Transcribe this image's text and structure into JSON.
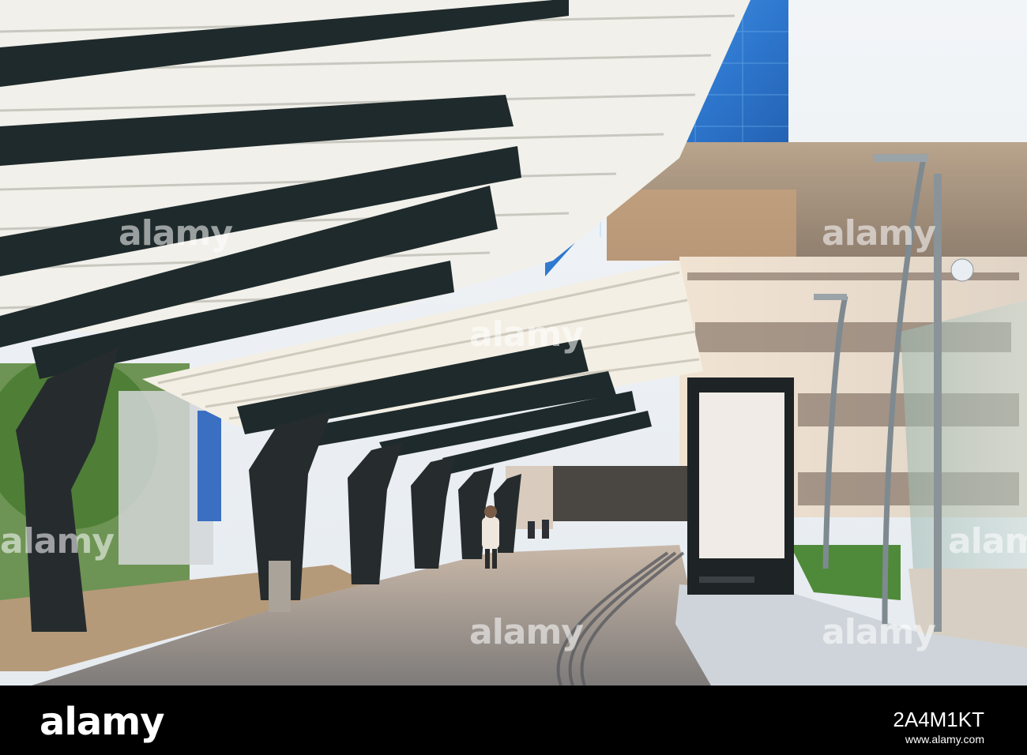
{
  "watermark": {
    "text": "alamy"
  },
  "footer": {
    "logo": "alamy",
    "image_id": "2A4M1KT",
    "url": "www.alamy.com"
  },
  "colors": {
    "sky": "#eef2f6",
    "glass_tower": "#2f7fd6",
    "beam": "#1f2a2c",
    "louver": "#f1f0ea",
    "pavement": "#8f8a86",
    "building": "#e9dccb"
  }
}
